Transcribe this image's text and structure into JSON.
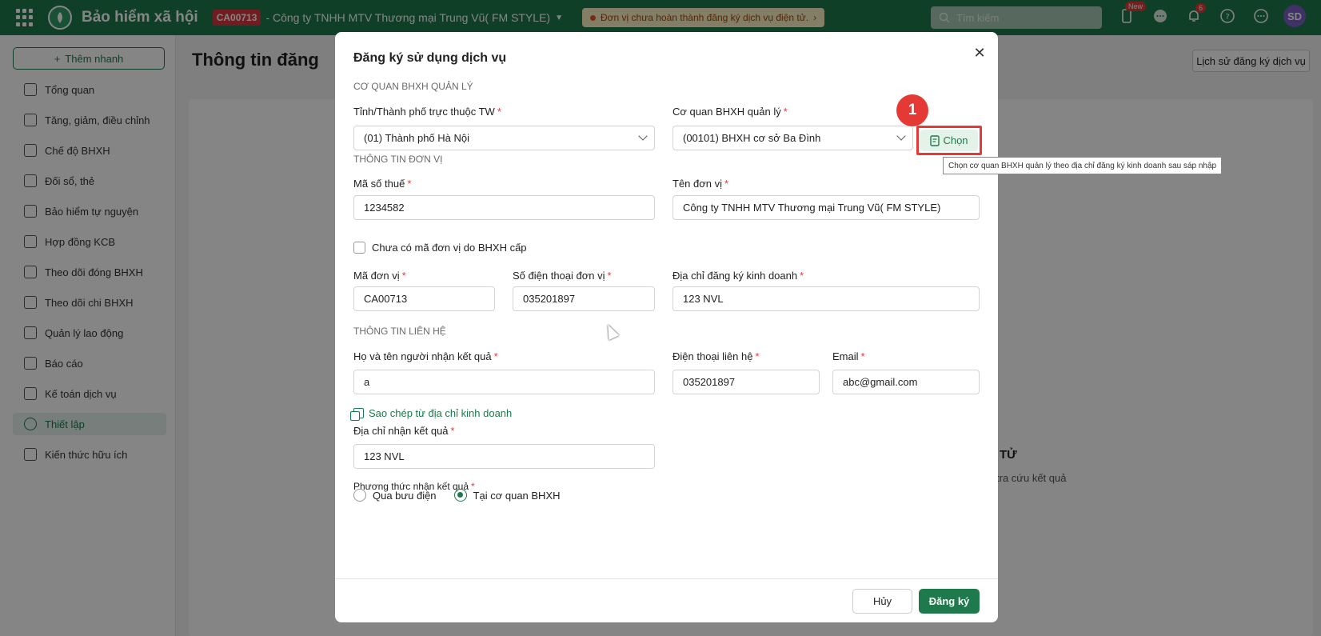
{
  "topbar": {
    "app_title": "Bảo hiểm xã hội",
    "unit_code": "CA00713",
    "unit_name": "- Công ty TNHH MTV Thương mại Trung Vũ( FM STYLE)",
    "warning": "Đơn vị chưa hoàn thành đăng ký dịch vụ điện tử.",
    "search_placeholder": "Tìm kiếm",
    "badge_new": "New",
    "notif_count": "6",
    "avatar_initials": "SD",
    "brand_color": "#1e7a4c"
  },
  "sidebar": {
    "add_label": "Thêm nhanh",
    "items": [
      {
        "label": "Tổng quan",
        "icon": "home-icon"
      },
      {
        "label": "Tăng, giảm, điều chỉnh",
        "icon": "user-plus-icon"
      },
      {
        "label": "Chế độ BHXH",
        "icon": "shield-icon"
      },
      {
        "label": "Đối sổ, thẻ",
        "icon": "card-icon"
      },
      {
        "label": "Bảo hiểm tự nguyện",
        "icon": "shield-heart-icon"
      },
      {
        "label": "Hợp đồng KCB",
        "icon": "document-icon"
      },
      {
        "label": "Theo dõi đóng BHXH",
        "icon": "calendar-icon"
      },
      {
        "label": "Theo dõi chi BHXH",
        "icon": "calendar-out-icon"
      },
      {
        "label": "Quản lý lao động",
        "icon": "users-icon"
      },
      {
        "label": "Báo cáo",
        "icon": "clipboard-icon"
      },
      {
        "label": "Kế toán dịch vụ",
        "icon": "accounting-icon"
      },
      {
        "label": "Thiết lập",
        "icon": "gear-icon",
        "active": true
      },
      {
        "label": "Kiến thức hữu ích",
        "icon": "knowledge-icon"
      }
    ]
  },
  "main": {
    "page_title": "Thông tin đăng",
    "history_button": "Lịch sử đăng ký dịch vụ",
    "bg_heading": "TỬ",
    "bg_text": "tra cứu kết quả"
  },
  "modal": {
    "title": "Đăng ký sử dụng dịch vụ",
    "section_agency": "CƠ QUAN BHXH QUẢN LÝ",
    "province_label": "Tỉnh/Thành phố trực thuộc TW",
    "province_value": "(01) Thành phố Hà Nội",
    "agency_label": "Cơ quan BHXH quản lý",
    "agency_value": "(00101) BHXH cơ sở Ba Đình",
    "choose_button": "Chọn",
    "step_number": "1",
    "tooltip": "Chọn cơ quan BHXH quản lý theo địa chỉ đăng ký kinh doanh sau sáp nhập",
    "section_unit": "THÔNG TIN ĐƠN VỊ",
    "tax_label": "Mã số thuế",
    "tax_value": "1234582",
    "unit_name_label": "Tên đơn vị",
    "unit_name_value": "Công ty TNHH MTV Thương mại Trung Vũ( FM STYLE)",
    "no_code_checkbox": "Chưa có mã đơn vị do BHXH cấp",
    "unit_code_label": "Mã đơn vị",
    "unit_code_value": "CA00713",
    "unit_phone_label": "Số điện thoại đơn vị",
    "unit_phone_value": "035201897",
    "address_label": "Địa chỉ đăng ký kinh doanh",
    "address_value": "123 NVL",
    "section_contact": "THÔNG TIN LIÊN HỆ",
    "receiver_label": "Họ và tên người nhận kết quả",
    "receiver_value": "a",
    "contact_phone_label": "Điện thoại liên hệ",
    "contact_phone_value": "035201897",
    "email_label": "Email",
    "email_value": "abc@gmail.com",
    "copy_link": "Sao chép từ địa chỉ kinh doanh",
    "result_address_label": "Địa chỉ nhận kết quả",
    "result_address_value": "123 NVL",
    "method_label": "Phương thức nhận kết quả",
    "method_post": "Qua bưu điện",
    "method_office": "Tại cơ quan BHXH",
    "cancel_button": "Hủy",
    "submit_button": "Đăng ký"
  }
}
